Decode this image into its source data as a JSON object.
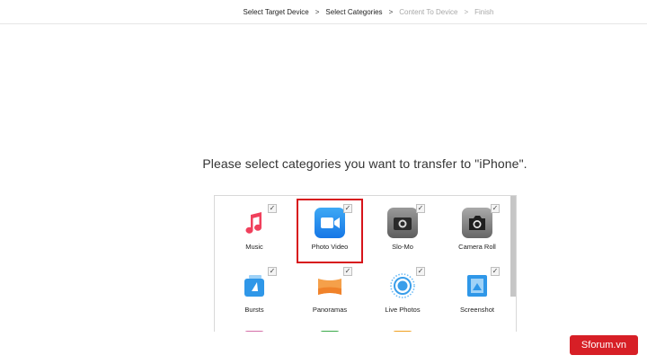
{
  "breadcrumb": {
    "steps": [
      {
        "label": "Select Target Device",
        "active": true
      },
      {
        "label": "Select Categories",
        "active": true
      },
      {
        "label": "Content To Device",
        "active": false
      },
      {
        "label": "Finish",
        "active": false
      }
    ],
    "separator": ">"
  },
  "prompt": "Please select categories you want to transfer to \"iPhone\".",
  "categories": [
    {
      "label": "Music",
      "icon": "music-note-icon",
      "checked": true,
      "selected": false
    },
    {
      "label": "Photo Video",
      "icon": "video-camera-icon",
      "checked": true,
      "selected": true
    },
    {
      "label": "Slo-Mo",
      "icon": "slomo-camera-icon",
      "checked": true,
      "selected": false
    },
    {
      "label": "Camera Roll",
      "icon": "camera-icon",
      "checked": true,
      "selected": false
    },
    {
      "label": "Bursts",
      "icon": "bursts-icon",
      "checked": true,
      "selected": false
    },
    {
      "label": "Panoramas",
      "icon": "panorama-icon",
      "checked": true,
      "selected": false
    },
    {
      "label": "Live Photos",
      "icon": "live-photos-icon",
      "checked": true,
      "selected": false
    },
    {
      "label": "Screenshot",
      "icon": "screenshot-icon",
      "checked": true,
      "selected": false
    }
  ],
  "check_mark": "✓",
  "watermark": "Sforum.vn",
  "colors": {
    "highlight": "#d7141a",
    "watermark_bg": "#d71f26"
  }
}
